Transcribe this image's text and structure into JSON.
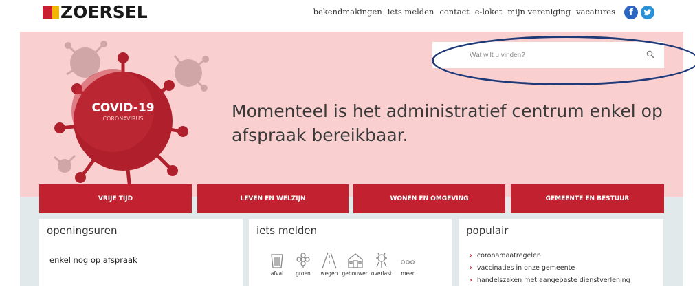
{
  "header": {
    "logo_text": "ZOERSEL",
    "nav": [
      "bekendmakingen",
      "iets melden",
      "contact",
      "e-loket",
      "mijn vereniging",
      "vacatures"
    ],
    "social": {
      "facebook": "f",
      "twitter": "t"
    }
  },
  "hero": {
    "badge_title": "COVID-19",
    "badge_subtitle": "CORONAVIRUS",
    "message": "Momenteel is het administratief centrum enkel op afspraak bereikbaar.",
    "search_placeholder": "Wat wilt u vinden?"
  },
  "main_nav": [
    "VRIJE TIJD",
    "LEVEN EN WELZIJN",
    "WONEN EN OMGEVING",
    "GEMEENTE EN BESTUUR"
  ],
  "cards": {
    "openingsuren": {
      "title": "openingsuren",
      "text": "enkel nog op afspraak"
    },
    "iets_melden": {
      "title": "iets melden",
      "items": [
        "afval",
        "groen",
        "wegen",
        "gebouwen",
        "overlast",
        "meer"
      ]
    },
    "populair": {
      "title": "populair",
      "items": [
        "coronamaatregelen",
        "vaccinaties in onze gemeente",
        "handelszaken met aangepaste dienstverlening"
      ]
    }
  },
  "colors": {
    "brand_red": "#c22130",
    "hero_bg": "#f9cfcf",
    "annotation": "#1f3a79"
  }
}
